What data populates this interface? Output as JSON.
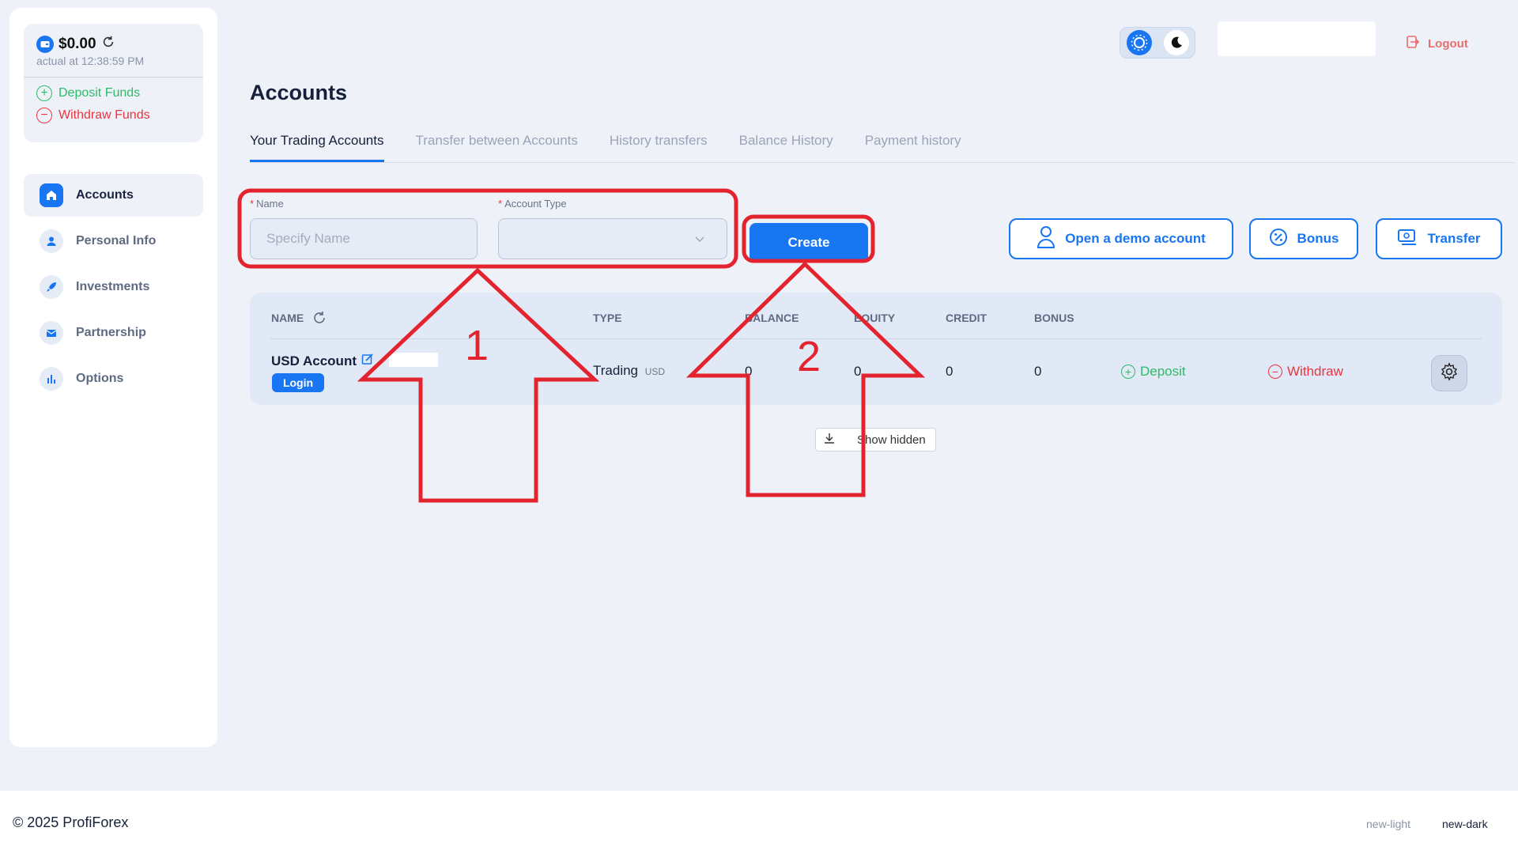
{
  "sidebar": {
    "balance": "$0.00",
    "balance_time": "actual at 12:38:59 PM",
    "deposit_label": "Deposit Funds",
    "withdraw_label": "Withdraw Funds",
    "items": [
      {
        "label": "Accounts",
        "icon": "home-icon",
        "active": true
      },
      {
        "label": "Personal Info",
        "icon": "user-icon"
      },
      {
        "label": "Investments",
        "icon": "rocket-icon"
      },
      {
        "label": "Partnership",
        "icon": "envelope-icon"
      },
      {
        "label": "Options",
        "icon": "bar-chart-icon"
      }
    ]
  },
  "header": {
    "logout_label": "Logout"
  },
  "page": {
    "title": "Accounts",
    "tabs": [
      {
        "label": "Your Trading Accounts",
        "active": true
      },
      {
        "label": "Transfer between Accounts"
      },
      {
        "label": "History transfers"
      },
      {
        "label": "Balance History"
      },
      {
        "label": "Payment history"
      }
    ]
  },
  "form": {
    "name_label": "Name",
    "name_placeholder": "Specify Name",
    "type_label": "Account Type",
    "create_label": "Create",
    "demo_label": "Open a demo account",
    "bonus_label": "Bonus",
    "transfer_label": "Transfer"
  },
  "table": {
    "headers": [
      "NAME",
      "TYPE",
      "BALANCE",
      "EQUITY",
      "CREDIT",
      "BONUS"
    ],
    "rows": [
      {
        "name": "USD Account",
        "login_label": "Login",
        "type": "Trading",
        "currency": "USD",
        "balance": "0",
        "equity": "0",
        "credit": "0",
        "bonus": "0",
        "deposit_label": "Deposit",
        "withdraw_label": "Withdraw"
      }
    ],
    "show_hidden_label": "Show hidden"
  },
  "annotations": {
    "step1": "1",
    "step2": "2"
  },
  "footer": {
    "copyright": "© 2025 ProfiForex",
    "theme_light": "new-light",
    "theme_dark": "new-dark"
  },
  "colors": {
    "primary": "#1876f2",
    "success": "#2dbb68",
    "danger": "#e8353f",
    "annotation": "#e3242f"
  }
}
